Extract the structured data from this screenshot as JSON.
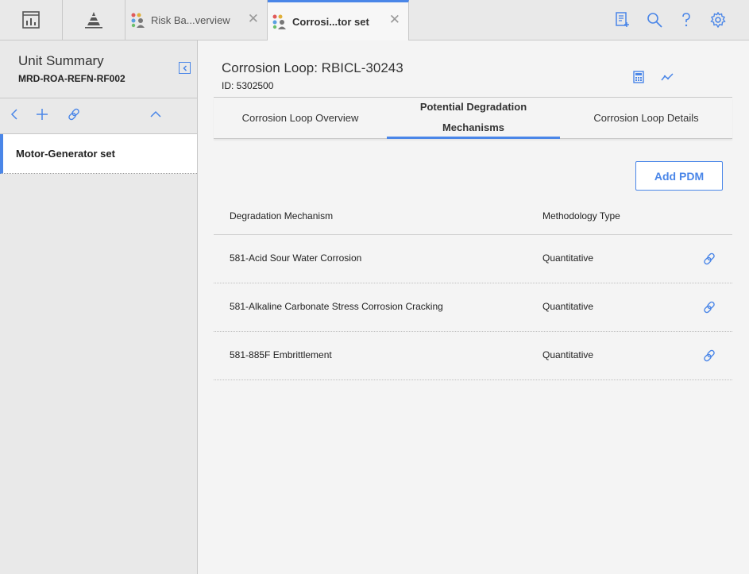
{
  "topbar": {
    "tabs": [
      {
        "label": "Risk Ba...verview",
        "icon": "team-icon"
      },
      {
        "label": "Corrosi...tor set",
        "icon": "team-icon"
      }
    ],
    "close_symbol": "✕"
  },
  "sidebar": {
    "title": "Unit Summary",
    "subtitle": "MRD-ROA-REFN-RF002",
    "items": [
      {
        "label": "Motor-Generator set"
      }
    ]
  },
  "main": {
    "title": "Corrosion Loop: RBICL-30243",
    "id_text": "ID: 5302500",
    "tabs": [
      {
        "label": "Corrosion Loop Overview"
      },
      {
        "label": "Potential Degradation Mechanisms"
      },
      {
        "label": "Corrosion Loop Details"
      }
    ],
    "add_button": "Add PDM",
    "table": {
      "headers": [
        "Degradation Mechanism",
        "Methodology Type"
      ],
      "rows": [
        {
          "mechanism": "581-Acid Sour Water Corrosion",
          "type": "Quantitative"
        },
        {
          "mechanism": "581-Alkaline Carbonate Stress Corrosion Cracking",
          "type": "Quantitative"
        },
        {
          "mechanism": "581-885F Embrittlement",
          "type": "Quantitative"
        }
      ]
    }
  },
  "colors": {
    "accent": "#4a86e8",
    "topbar": "#e9e9e9",
    "panel": "#f4f4f4"
  }
}
